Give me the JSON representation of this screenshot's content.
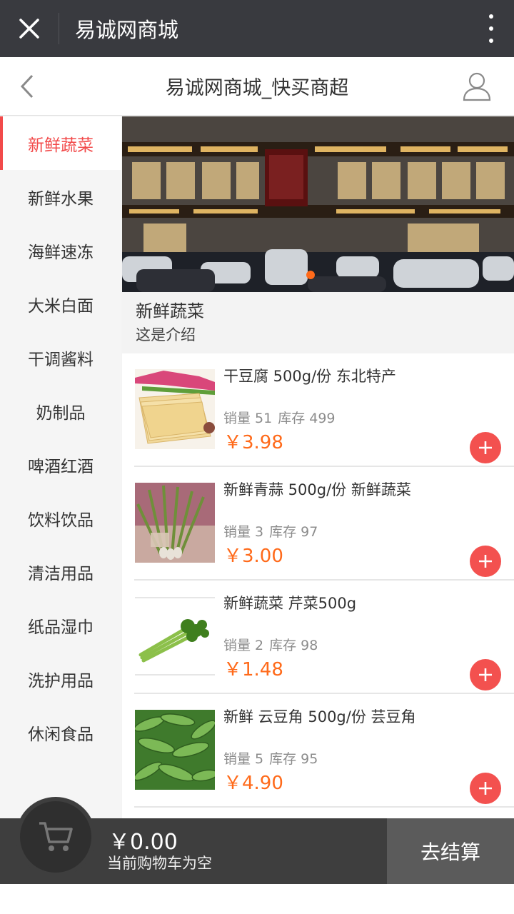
{
  "wechat_bar": {
    "title": "易诚网商城"
  },
  "header": {
    "title": "易诚网商城_快买商超"
  },
  "sidebar": {
    "items": [
      {
        "label": "新鲜蔬菜",
        "active": true
      },
      {
        "label": "新鲜水果"
      },
      {
        "label": "海鲜速冻"
      },
      {
        "label": "大米白面"
      },
      {
        "label": "干调酱料"
      },
      {
        "label": "奶制品"
      },
      {
        "label": "啤酒红酒"
      },
      {
        "label": "饮料饮品"
      },
      {
        "label": "清洁用品"
      },
      {
        "label": "纸品湿巾"
      },
      {
        "label": "洗护用品"
      },
      {
        "label": "休闲食品"
      }
    ]
  },
  "category": {
    "name": "新鲜蔬菜",
    "description": "这是介绍"
  },
  "products": [
    {
      "name": "干豆腐 500g/份 东北特产",
      "sales": "销量 51",
      "stock": "库存 499",
      "price": "￥3.98"
    },
    {
      "name": "新鲜青蒜 500g/份 新鲜蔬菜",
      "sales": "销量 3",
      "stock": "库存 97",
      "price": "￥3.00"
    },
    {
      "name": "新鲜蔬菜 芹菜500g",
      "sales": "销量 2",
      "stock": "库存 98",
      "price": "￥1.48"
    },
    {
      "name": "新鲜 云豆角 500g/份 芸豆角",
      "sales": "销量 5",
      "stock": "库存 95",
      "price": "￥4.90"
    }
  ],
  "cart": {
    "total": "￥0.00",
    "status": "当前购物车为空",
    "checkout_label": "去结算"
  },
  "colors": {
    "accent": "#f24a4a",
    "price": "#ff6a1a",
    "add_button": "#f3514f"
  }
}
